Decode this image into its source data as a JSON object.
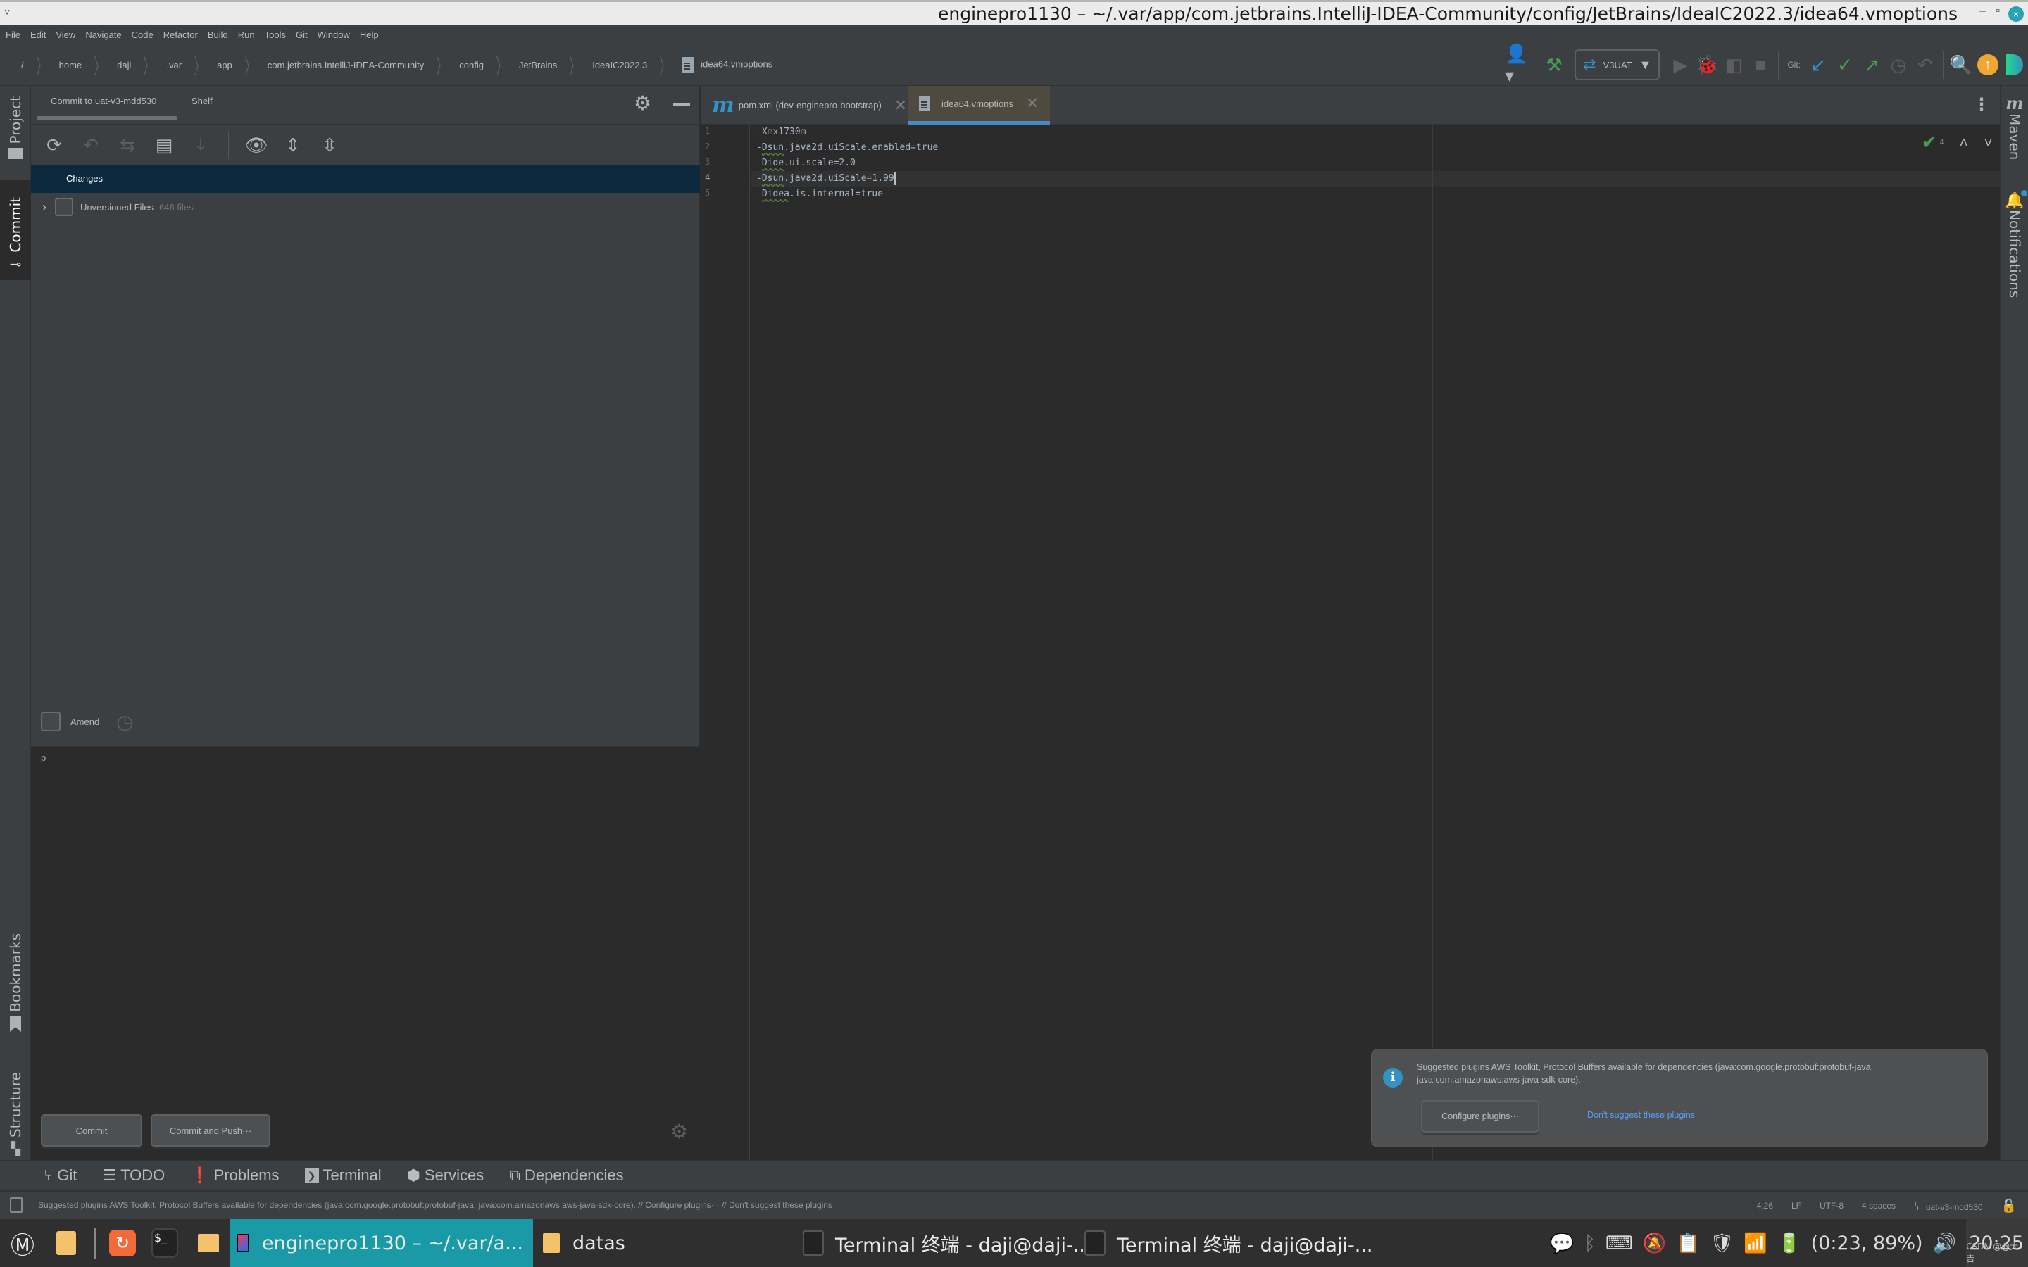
{
  "window": {
    "title": "enginepro1130 – ~/.var/app/com.jetbrains.IntelliJ-IDEA-Community/config/JetBrains/IdeaIC2022.3/idea64.vmoptions",
    "minimize": "–",
    "maximize": "▫",
    "close": "×",
    "left_chevron": "˅"
  },
  "menu": [
    "File",
    "Edit",
    "View",
    "Navigate",
    "Code",
    "Refactor",
    "Build",
    "Run",
    "Tools",
    "Git",
    "Window",
    "Help"
  ],
  "breadcrumb": [
    "/",
    "home",
    "daji",
    ".var",
    "app",
    "com.jetbrains.IntelliJ-IDEA-Community",
    "config",
    "JetBrains",
    "IdeaIC2022.3",
    "idea64.vmoptions"
  ],
  "toolbar": {
    "run_config": "V3UAT",
    "git_label": "Git:"
  },
  "left_stripe": {
    "top": [
      "Project",
      "Commit"
    ],
    "bottom": [
      "Bookmarks",
      "Structure"
    ]
  },
  "commit_panel": {
    "tabs": [
      "Commit to uat-v3-mdd530",
      "Shelf"
    ],
    "changes_label": "Changes",
    "unversioned_label": "Unversioned Files",
    "unversioned_count": "646 files",
    "amend_label": "Amend",
    "message": "p",
    "commit_button": "Commit",
    "commit_push_button": "Commit and Push···"
  },
  "editor": {
    "tabs": [
      {
        "label": "pom.xml (dev-enginepro-bootstrap)",
        "icon": "m",
        "active": false
      },
      {
        "label": "idea64.vmoptions",
        "active": true
      }
    ],
    "lines": [
      {
        "num": "1",
        "dash": "-",
        "word": "",
        "rest": "Xmx1730m"
      },
      {
        "num": "2",
        "dash": "-",
        "word": "Dsun",
        "rest": ".java2d.uiScale.enabled=true"
      },
      {
        "num": "3",
        "dash": "-",
        "word": "Dide",
        "rest": ".ui.scale=2.0"
      },
      {
        "num": "4",
        "dash": "-",
        "word": "Dsun",
        "rest": ".java2d.uiScale=1.99"
      },
      {
        "num": "5",
        "dash": "-",
        "word": "Didea",
        "rest": ".is.internal=true"
      }
    ],
    "current_line": 4,
    "inspection_count": "4"
  },
  "right_stripe": [
    "Maven",
    "Notifications"
  ],
  "notification": {
    "message": "Suggested plugins AWS Toolkit, Protocol Buffers available for dependencies (java:com.google.protobuf:protobuf-java, java:com.amazonaws:aws-java-sdk-core).",
    "configure_button": "Configure plugins···",
    "dismiss_link": "Don't suggest these plugins",
    "icon": "i"
  },
  "bottom_tabs": [
    "Git",
    "TODO",
    "Problems",
    "Terminal",
    "Services",
    "Dependencies"
  ],
  "status": {
    "message": "Suggested plugins AWS Toolkit, Protocol Buffers available for dependencies (java:com.google.protobuf:protobuf-java, java:com.amazonaws:aws-java-sdk-core). // Configure plugins··· // Don't suggest these plugins",
    "position": "4:26",
    "line_sep": "LF",
    "encoding": "UTF-8",
    "indent": "4 spaces",
    "branch": "uat-v3-mdd530"
  },
  "taskbar": {
    "active_window": "enginepro1130 – ~/.var/a...",
    "folder_window": "datas",
    "terminal1": "Terminal 终端 - daji@daji-...",
    "terminal2": "Terminal 终端 - daji@daji-...",
    "battery": "(0:23, 89%)",
    "clock": "20:25",
    "watermark": "CSDN @@大吉"
  }
}
